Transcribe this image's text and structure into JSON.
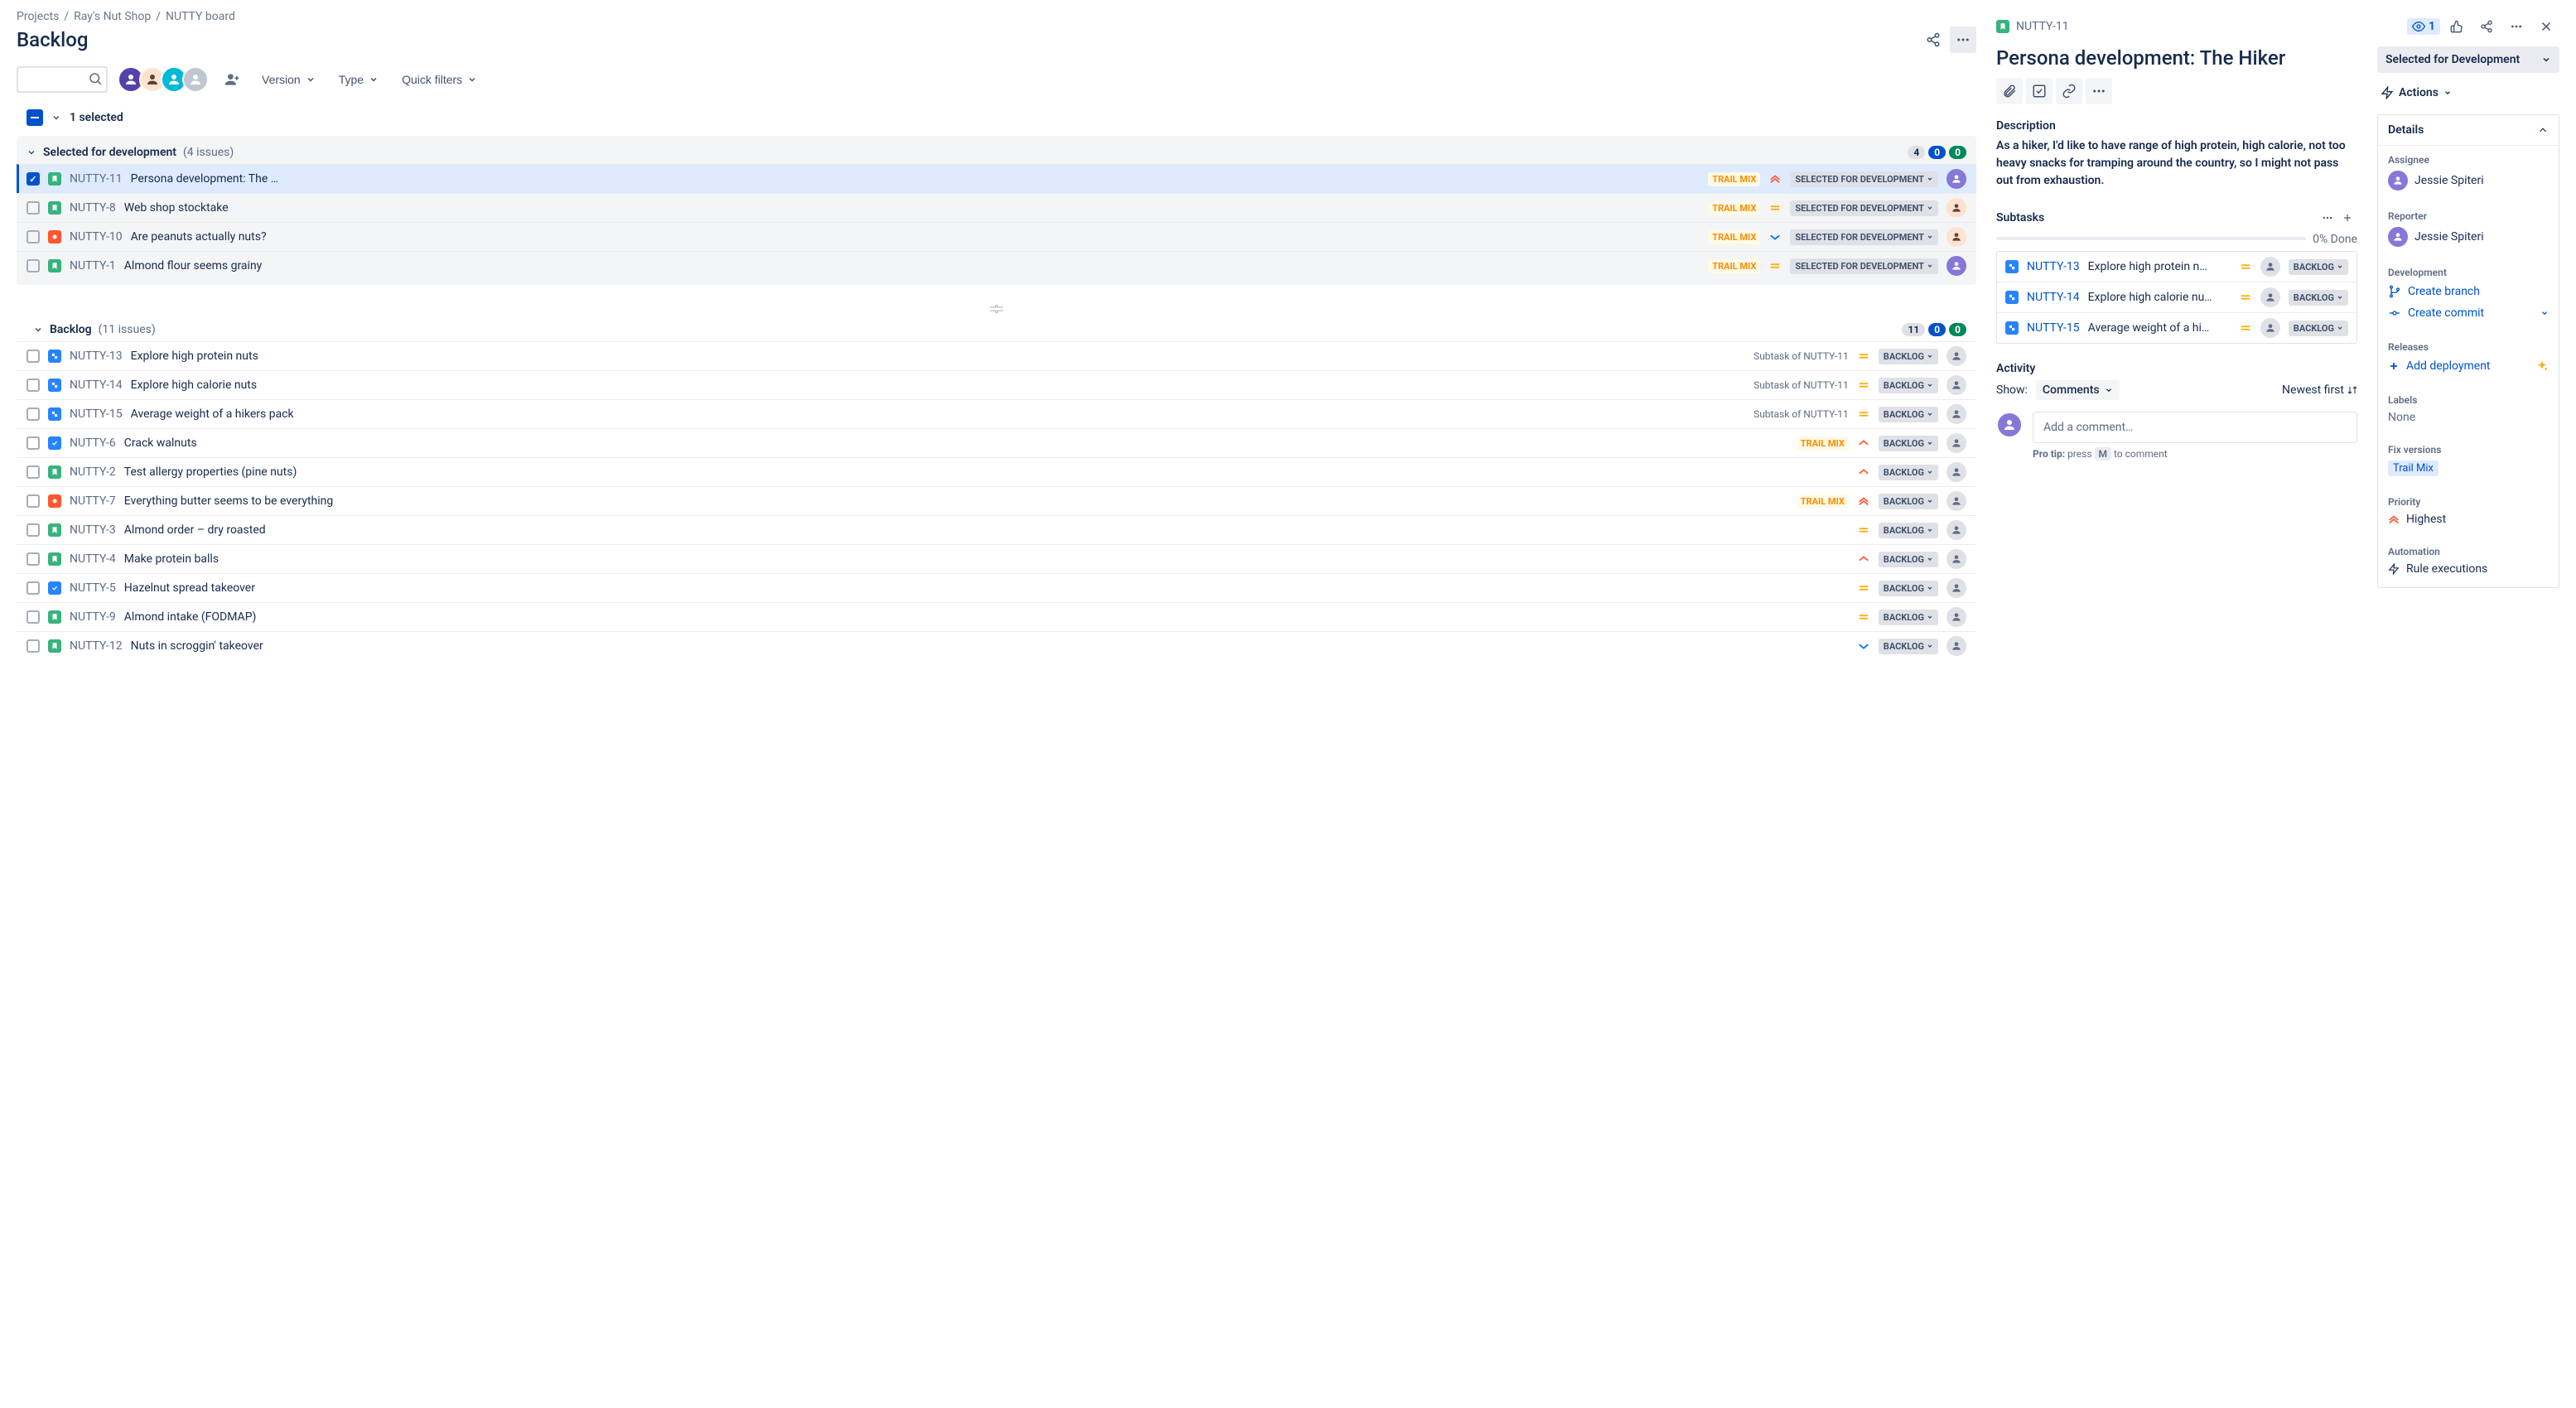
{
  "breadcrumb": {
    "projects": "Projects",
    "project": "Ray's Nut Shop",
    "board": "NUTTY board"
  },
  "page_title": "Backlog",
  "toolbar": {
    "version": "Version",
    "type": "Type",
    "quick_filters": "Quick filters"
  },
  "selection": {
    "count": "1 selected"
  },
  "sections": {
    "dev": {
      "title": "Selected for development",
      "count": "(4 issues)",
      "badges": {
        "grey": "4",
        "blue": "0",
        "green": "0"
      }
    },
    "backlog": {
      "title": "Backlog",
      "count": "(11 issues)",
      "badges": {
        "grey": "11",
        "blue": "0",
        "green": "0"
      }
    }
  },
  "epic_trailmix": "TRAIL MIX",
  "status": {
    "selected_dev": "SELECTED FOR DEVELOPMENT",
    "backlog": "BACKLOG"
  },
  "dev_issues": [
    {
      "key": "NUTTY-11",
      "summary": "Persona development: The …",
      "status": "SELECTED FOR DEVELOPMENT"
    },
    {
      "key": "NUTTY-8",
      "summary": "Web shop stocktake",
      "status": "SELECTED FOR DEVELOPMENT"
    },
    {
      "key": "NUTTY-10",
      "summary": "Are peanuts actually nuts?",
      "status": "SELECTED FOR DEVELOPMENT"
    },
    {
      "key": "NUTTY-1",
      "summary": "Almond flour seems grainy",
      "status": "SELECTED FOR DEVELOPMENT"
    }
  ],
  "backlog_issues": [
    {
      "key": "NUTTY-13",
      "summary": "Explore high protein nuts",
      "parent": "Subtask of NUTTY-11",
      "status": "BACKLOG"
    },
    {
      "key": "NUTTY-14",
      "summary": "Explore high calorie nuts",
      "parent": "Subtask of NUTTY-11",
      "status": "BACKLOG"
    },
    {
      "key": "NUTTY-15",
      "summary": "Average weight of a hikers pack",
      "parent": "Subtask of NUTTY-11",
      "status": "BACKLOG"
    },
    {
      "key": "NUTTY-6",
      "summary": "Crack walnuts",
      "status": "BACKLOG"
    },
    {
      "key": "NUTTY-2",
      "summary": "Test allergy properties (pine nuts)",
      "status": "BACKLOG"
    },
    {
      "key": "NUTTY-7",
      "summary": "Everything butter seems to be everything",
      "status": "BACKLOG"
    },
    {
      "key": "NUTTY-3",
      "summary": "Almond order – dry roasted",
      "status": "BACKLOG"
    },
    {
      "key": "NUTTY-4",
      "summary": "Make protein balls",
      "status": "BACKLOG"
    },
    {
      "key": "NUTTY-5",
      "summary": "Hazelnut spread takeover",
      "status": "BACKLOG"
    },
    {
      "key": "NUTTY-9",
      "summary": "Almond intake (FODMAP)",
      "status": "BACKLOG"
    },
    {
      "key": "NUTTY-12",
      "summary": "Nuts in scroggin' takeover",
      "status": "BACKLOG"
    }
  ],
  "detail": {
    "key": "NUTTY-11",
    "watch_count": "1",
    "title": "Persona development: The Hiker",
    "status_big": "Selected for Development",
    "actions_label": "Actions",
    "description_label": "Description",
    "description": "As a hiker, I'd like to have range of high protein, high calorie, not too heavy snacks for tramping around the country, so I might not pass out from exhaustion.",
    "subtasks_label": "Subtasks",
    "done_pct": "0% Done",
    "subtasks": [
      {
        "key": "NUTTY-13",
        "summary": "Explore high protein n…",
        "status": "BACKLOG"
      },
      {
        "key": "NUTTY-14",
        "summary": "Explore high calorie nu…",
        "status": "BACKLOG"
      },
      {
        "key": "NUTTY-15",
        "summary": "Average weight of a hi…",
        "status": "BACKLOG"
      }
    ],
    "activity_label": "Activity",
    "show_label": "Show:",
    "comments_label": "Comments",
    "sort_label": "Newest first",
    "comment_placeholder": "Add a comment…",
    "protip_prefix": "Pro tip:",
    "protip_press": "press",
    "protip_key": "M",
    "protip_rest": "to comment",
    "details_panel_title": "Details",
    "assignee_label": "Assignee",
    "assignee": "Jessie Spiteri",
    "reporter_label": "Reporter",
    "reporter": "Jessie Spiteri",
    "development_label": "Development",
    "create_branch": "Create branch",
    "create_commit": "Create commit",
    "releases_label": "Releases",
    "add_deployment": "Add deployment",
    "labels_label": "Labels",
    "labels_value": "None",
    "fix_versions_label": "Fix versions",
    "fix_version": "Trail Mix",
    "priority_label": "Priority",
    "priority_value": "Highest",
    "automation_label": "Automation",
    "automation_value": "Rule executions"
  },
  "colors": {
    "av1": "#5243AA",
    "av2": "#FFAB00",
    "av3": "#00B8D9",
    "av4": "#C1C7D0",
    "j1": "#8777D9",
    "j2": "#00875A"
  }
}
